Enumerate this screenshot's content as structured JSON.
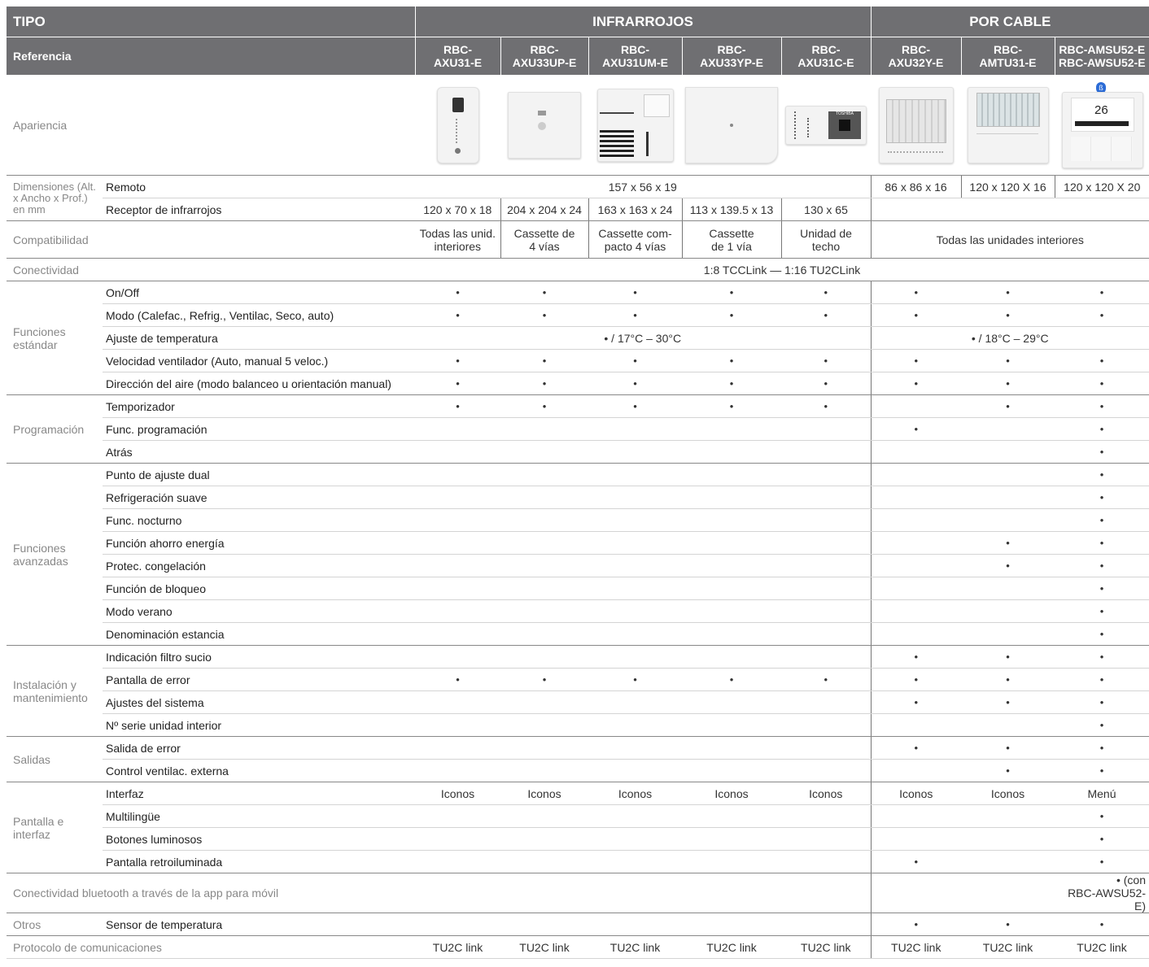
{
  "header": {
    "tipo_label": "TIPO",
    "infrarrojos_label": "INFRARROJOS",
    "porcable_label": "POR CABLE",
    "referencia_label": "Referencia",
    "refs": [
      [
        "RBC-",
        "AXU31-E"
      ],
      [
        "RBC-",
        "AXU33UP-E"
      ],
      [
        "RBC-",
        "AXU31UM-E"
      ],
      [
        "RBC-",
        "AXU33YP-E"
      ],
      [
        "RBC-",
        "AXU31C-E"
      ],
      [
        "RBC-",
        "AXU32Y-E"
      ],
      [
        "RBC-",
        "AMTU31-E"
      ],
      [
        "RBC-AMSU52-E",
        "RBC-AWSU52-E"
      ]
    ]
  },
  "apariencia": {
    "label": "Apariencia",
    "brand": "TOSHIBA",
    "temp": "26"
  },
  "dimensiones": {
    "label": "Dimensiones (Alt. x Ancho x Prof.) en mm",
    "remoto_label": "Remoto",
    "remoto_ir": "157 x 56 x 19",
    "remoto_cable": [
      "86 x 86 x 16",
      "120 x 120 X 16",
      "120 x 120 X 20"
    ],
    "receptor_label": "Receptor de infrarrojos",
    "receptor": [
      "120 x 70 x 18",
      "204 x 204 x 24",
      "163 x 163 x 24",
      "113 x 139.5 x 13",
      "130 x 65"
    ]
  },
  "compatibilidad": {
    "label": "Compatibilidad",
    "ir": [
      [
        "Todas las unid.",
        "interiores"
      ],
      [
        "Cassette de",
        "4 vías"
      ],
      [
        "Cassette com-",
        "pacto 4 vías"
      ],
      [
        "Cassette",
        "de 1 vía"
      ],
      [
        "Unidad de",
        "techo"
      ]
    ],
    "cable": "Todas las unidades interiores"
  },
  "conectividad": {
    "label": "Conectividad",
    "value": "1:8 TCCLink — 1:16 TU2CLink"
  },
  "dot": "•",
  "funciones_estandar": {
    "label": "Funciones estándar",
    "rows": [
      "On/Off",
      "Modo (Calefac., Refrig., Ventilac, Seco, auto)",
      "Ajuste de temperatura",
      "Velocidad ventilador (Auto, manual 5 veloc.)",
      "Dirección del aire (modo balanceo u orientación manual)"
    ],
    "temp_ir": "• / 17°C – 30°C",
    "temp_cable": "• / 18°C – 29°C"
  },
  "programacion": {
    "label": "Programación",
    "rows": [
      "Temporizador",
      "Func. programación",
      "Atrás"
    ]
  },
  "funciones_avanzadas": {
    "label": "Funciones avanzadas",
    "rows": [
      "Punto de ajuste dual",
      "Refrigeración suave",
      "Func. nocturno",
      "Función ahorro energía",
      "Protec. congelación",
      "Función de bloqueo",
      "Modo verano",
      "Denominación  estancia"
    ]
  },
  "instalacion": {
    "label": "Instalación y mantenimiento",
    "rows": [
      "Indicación filtro sucio",
      "Pantalla de error",
      "Ajustes del sistema",
      "Nº serie unidad interior"
    ]
  },
  "salidas": {
    "label": "Salidas",
    "rows": [
      "Salida de error",
      "Control ventilac. externa"
    ]
  },
  "pantalla": {
    "label": "Pantalla e interfaz",
    "rows": [
      "Interfaz",
      "Multilingüe",
      "Botones luminosos",
      "Pantalla retroiluminada"
    ],
    "iconos": "Iconos",
    "menu": "Menú"
  },
  "bluetooth": {
    "label": "Conectividad bluetooth a través de la app para móvil",
    "value1": "•  (con",
    "value2": "RBC-AWSU52-E)"
  },
  "otros": {
    "label": "Otros",
    "row": "Sensor de temperatura"
  },
  "protocolo": {
    "label": "Protocolo de comunicaciones",
    "value": "TU2C link"
  }
}
